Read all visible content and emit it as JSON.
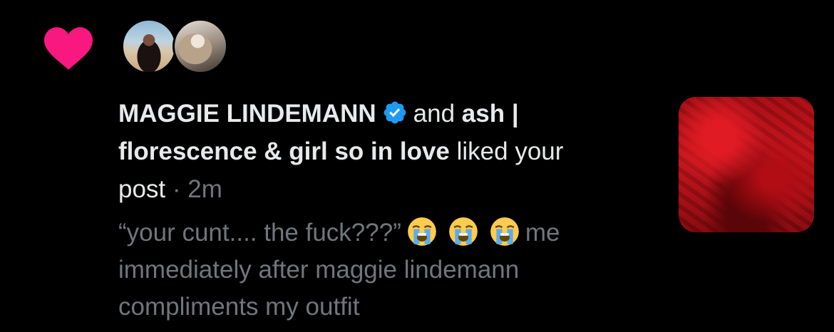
{
  "notification": {
    "type": "like",
    "icon": "heart-icon",
    "heart_color": "#f91880",
    "user1_name": "MAGGIE LINDEMANN",
    "user1_verified_icon": "verified-badge-icon",
    "joiner": "and",
    "user2_name_part1": "ash |",
    "user2_name_part2": "florescence & girl so in love",
    "action": "liked your",
    "object": "post",
    "separator": "·",
    "time": "2m",
    "post_text_1": "“your cunt....  the fuck???”",
    "emoji_name": "loudly-crying-face-icon",
    "post_text_2": "me",
    "post_text_3": "immediately after maggie lindemann",
    "post_text_4": "compliments my outfit"
  },
  "colors": {
    "background": "#000000",
    "text_primary": "#e7e9ea",
    "text_secondary": "#71767b",
    "verified_blue": "#1d9bf0"
  }
}
